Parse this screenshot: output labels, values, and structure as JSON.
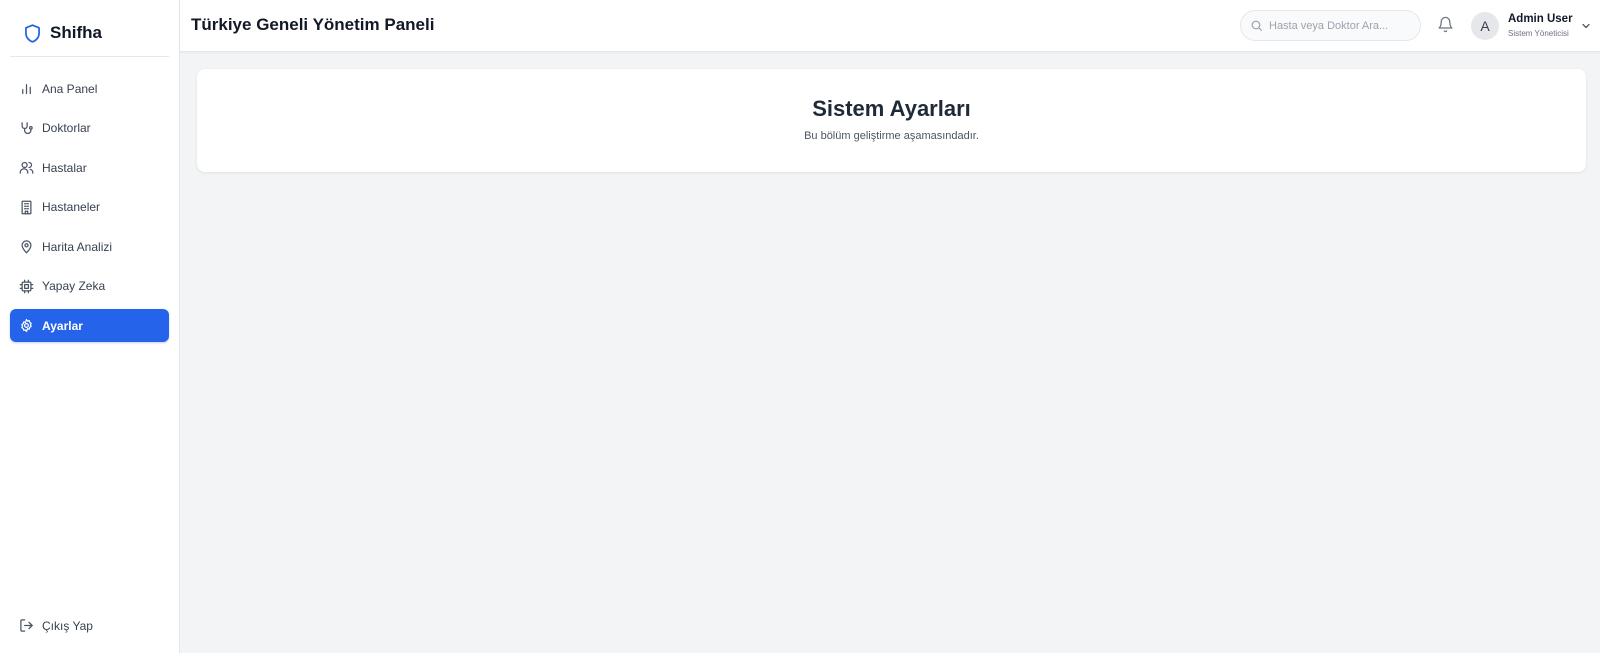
{
  "brand": {
    "name": "Shifha",
    "icon": "shield-icon",
    "color": "#2563eb"
  },
  "sidebar": {
    "items": [
      {
        "label": "Ana Panel",
        "icon": "bar-chart-icon",
        "active": false
      },
      {
        "label": "Doktorlar",
        "icon": "stethoscope-icon",
        "active": false
      },
      {
        "label": "Hastalar",
        "icon": "users-icon",
        "active": false
      },
      {
        "label": "Hastaneler",
        "icon": "building-icon",
        "active": false
      },
      {
        "label": "Harita Analizi",
        "icon": "map-pin-icon",
        "active": false
      },
      {
        "label": "Yapay Zeka",
        "icon": "cpu-icon",
        "active": false
      },
      {
        "label": "Ayarlar",
        "icon": "gear-icon",
        "active": true
      }
    ],
    "logout": {
      "label": "Çıkış Yap",
      "icon": "logout-icon"
    }
  },
  "header": {
    "title": "Türkiye Geneli Yönetim Paneli",
    "search": {
      "placeholder": "Hasta veya Doktor Ara...",
      "value": ""
    },
    "user": {
      "avatar_letter": "A",
      "name": "Admin User",
      "role": "Sistem Yöneticisi"
    }
  },
  "main": {
    "title": "Sistem Ayarları",
    "subtitle": "Bu bölüm geliştirme aşamasındadır."
  },
  "colors": {
    "accent": "#2563eb",
    "background": "#f3f4f6",
    "surface": "#ffffff"
  }
}
